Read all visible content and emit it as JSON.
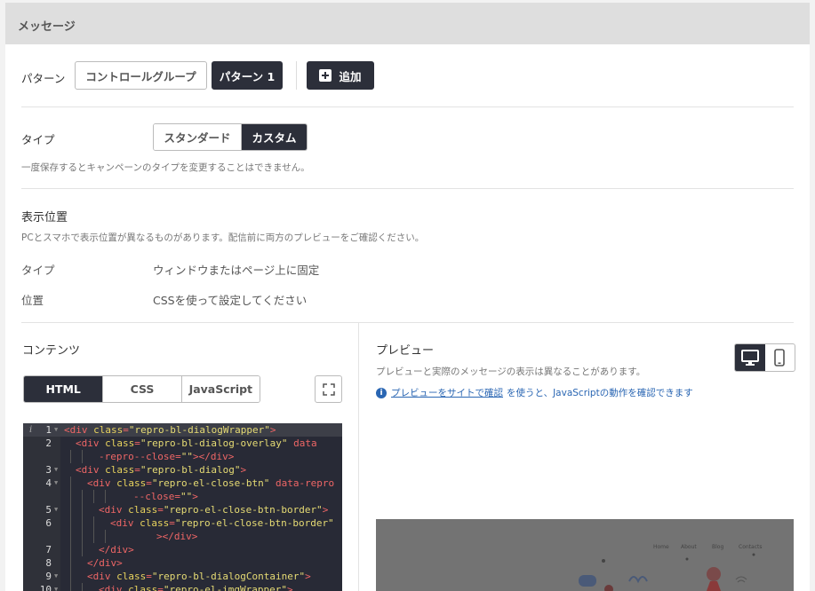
{
  "header": {
    "title": "メッセージ"
  },
  "pattern": {
    "label": "パターン",
    "tabs": [
      "コントロールグループ",
      "パターン 1"
    ],
    "add_label": "追加"
  },
  "type_section": {
    "label": "タイプ",
    "options": [
      "スタンダード",
      "カスタム"
    ],
    "selected": "カスタム",
    "hint": "一度保存するとキャンペーンのタイプを変更することはできません。"
  },
  "position_section": {
    "title": "表示位置",
    "hint": "PCとスマホで表示位置が異なるものがあります。配信前に両方のプレビューをご確認ください。",
    "type_label": "タイプ",
    "type_value": "ウィンドウまたはページ上に固定",
    "position_label": "位置",
    "position_value": "CSSを使って設定してください"
  },
  "content_section": {
    "title": "コンテンツ",
    "tabs": [
      "HTML",
      "CSS",
      "JavaScript"
    ],
    "selected": "HTML"
  },
  "editor": {
    "lines": [
      {
        "n": "1",
        "fold": true,
        "indent": 0,
        "tokens": [
          [
            "t",
            "<div "
          ],
          [
            "a",
            "class"
          ],
          [
            "t",
            "="
          ],
          [
            "s",
            "\"repro-bl-dialogWrapper\""
          ],
          [
            "t",
            ">"
          ]
        ]
      },
      {
        "n": "2",
        "fold": false,
        "indent": 1,
        "tokens": [
          [
            "t",
            "<div "
          ],
          [
            "a",
            "class"
          ],
          [
            "t",
            "="
          ],
          [
            "s",
            "\"repro-bl-dialog-overlay\""
          ],
          [
            "t",
            " data"
          ]
        ]
      },
      {
        "n": "",
        "fold": false,
        "indent": 3,
        "tokens": [
          [
            "t",
            "-repro--close"
          ],
          [
            "t",
            "="
          ],
          [
            "s",
            "\"\""
          ],
          [
            "t",
            "></div>"
          ]
        ]
      },
      {
        "n": "3",
        "fold": true,
        "indent": 1,
        "tokens": [
          [
            "t",
            "<div "
          ],
          [
            "a",
            "class"
          ],
          [
            "t",
            "="
          ],
          [
            "s",
            "\"repro-bl-dialog\""
          ],
          [
            "t",
            ">"
          ]
        ]
      },
      {
        "n": "4",
        "fold": true,
        "indent": 2,
        "tokens": [
          [
            "t",
            "<div "
          ],
          [
            "a",
            "class"
          ],
          [
            "t",
            "="
          ],
          [
            "s",
            "\"repro-el-close-btn\""
          ],
          [
            "t",
            " data-repro"
          ]
        ]
      },
      {
        "n": "",
        "fold": false,
        "indent": 6,
        "tokens": [
          [
            "t",
            "--close"
          ],
          [
            "t",
            "="
          ],
          [
            "s",
            "\"\""
          ],
          [
            "t",
            ">"
          ]
        ]
      },
      {
        "n": "5",
        "fold": true,
        "indent": 3,
        "tokens": [
          [
            "t",
            "<div "
          ],
          [
            "a",
            "class"
          ],
          [
            "t",
            "="
          ],
          [
            "s",
            "\"repro-el-close-btn-border\""
          ],
          [
            "t",
            ">"
          ]
        ]
      },
      {
        "n": "6",
        "fold": false,
        "indent": 4,
        "tokens": [
          [
            "t",
            "<div "
          ],
          [
            "a",
            "class"
          ],
          [
            "t",
            "="
          ],
          [
            "s",
            "\"repro-el-close-btn-border\""
          ]
        ]
      },
      {
        "n": "",
        "fold": false,
        "indent": 8,
        "tokens": [
          [
            "t",
            "></div>"
          ]
        ]
      },
      {
        "n": "7",
        "fold": false,
        "indent": 3,
        "tokens": [
          [
            "t",
            "</div>"
          ]
        ]
      },
      {
        "n": "8",
        "fold": false,
        "indent": 2,
        "tokens": [
          [
            "t",
            "</div>"
          ]
        ]
      },
      {
        "n": "9",
        "fold": true,
        "indent": 2,
        "tokens": [
          [
            "t",
            "<div "
          ],
          [
            "a",
            "class"
          ],
          [
            "t",
            "="
          ],
          [
            "s",
            "\"repro-bl-dialogContainer\""
          ],
          [
            "t",
            ">"
          ]
        ]
      },
      {
        "n": "10",
        "fold": true,
        "indent": 3,
        "tokens": [
          [
            "t",
            "<div "
          ],
          [
            "a",
            "class"
          ],
          [
            "t",
            "="
          ],
          [
            "s",
            "\"repro-el-imgWrapper\""
          ],
          [
            "t",
            ">"
          ]
        ]
      }
    ]
  },
  "preview_section": {
    "title": "プレビュー",
    "hint": "プレビューと実際のメッセージの表示は異なることがあります。",
    "info_link": "プレビューをサイトで確認",
    "info_rest": "を使うと、JavaScriptの動作を確認できます",
    "nav_items": [
      "Home",
      "About",
      "Blog",
      "Contacts"
    ]
  },
  "colors": {
    "dark": "#2c2f3a",
    "link": "#2a66b3"
  }
}
